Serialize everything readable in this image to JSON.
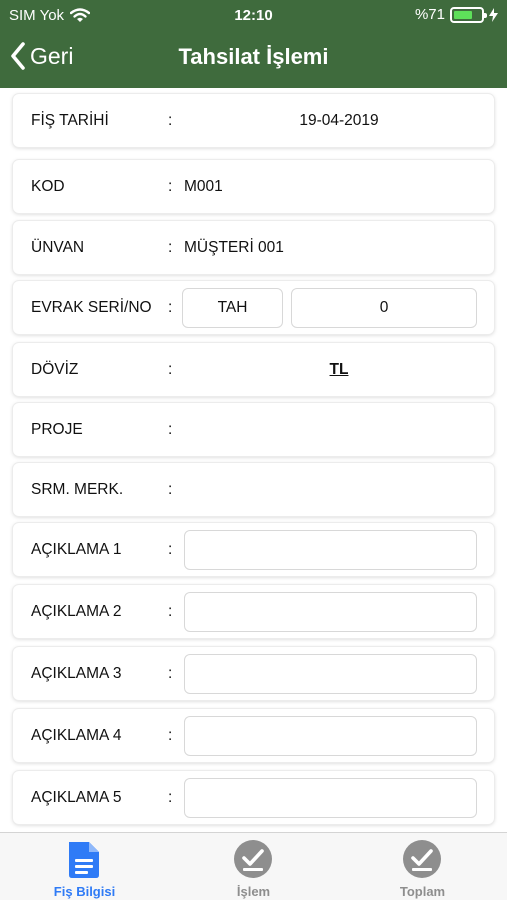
{
  "status_bar": {
    "carrier": "SIM Yok",
    "time": "12:10",
    "battery": "%71",
    "battery_level": 0.71
  },
  "nav": {
    "back_label": "Geri",
    "title": "Tahsilat İşlemi"
  },
  "form": {
    "colon": ":",
    "fis_tarihi": {
      "label": "FİŞ TARİHİ",
      "value": "19-04-2019"
    },
    "kod": {
      "label": "KOD",
      "value": "M001"
    },
    "unvan": {
      "label": "ÜNVAN",
      "value": "MÜŞTERİ 001"
    },
    "evrak": {
      "label": "EVRAK SERİ/NO",
      "seri": "TAH",
      "no": "0"
    },
    "doviz": {
      "label": "DÖVİZ",
      "value": "TL"
    },
    "proje": {
      "label": "PROJE",
      "value": ""
    },
    "srm": {
      "label": "SRM. MERK.",
      "value": ""
    },
    "aciklama": [
      {
        "label": "AÇIKLAMA 1",
        "value": ""
      },
      {
        "label": "AÇIKLAMA 2",
        "value": ""
      },
      {
        "label": "AÇIKLAMA 3",
        "value": ""
      },
      {
        "label": "AÇIKLAMA 4",
        "value": ""
      },
      {
        "label": "AÇIKLAMA 5",
        "value": ""
      }
    ]
  },
  "tabs": [
    {
      "label": "Fiş Bilgisi",
      "icon": "document-icon",
      "active": true
    },
    {
      "label": "İşlem",
      "icon": "check-circle-icon",
      "active": false
    },
    {
      "label": "Toplam",
      "icon": "check-circle-icon",
      "active": false
    }
  ],
  "colors": {
    "header_bg": "#3f6b3d",
    "active_tab": "#2f7bf6",
    "inactive_tab": "#8e8e8e"
  }
}
